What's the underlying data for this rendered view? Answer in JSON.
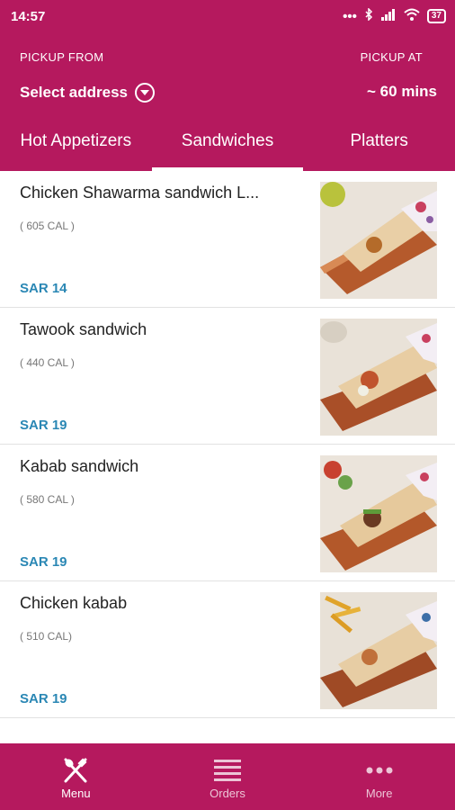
{
  "status_bar": {
    "time": "14:57",
    "battery": "37"
  },
  "header": {
    "pickup_from_label": "PICKUP FROM",
    "address": "Select address",
    "pickup_at_label": "PICKUP AT",
    "eta": "~ 60 mins"
  },
  "tabs": [
    {
      "label": "Hot Appetizers"
    },
    {
      "label": "Sandwiches"
    },
    {
      "label": "Platters"
    }
  ],
  "items": [
    {
      "name": "Chicken Shawarma sandwich L...",
      "calories": "( 605 CAL )",
      "price": "SAR 14"
    },
    {
      "name": "Tawook sandwich",
      "calories": "( 440 CAL )",
      "price": "SAR 19"
    },
    {
      "name": "Kabab sandwich",
      "calories": "( 580 CAL )",
      "price": "SAR 19"
    },
    {
      "name": "Chicken kabab",
      "calories": "( 510 CAL)",
      "price": "SAR 19"
    }
  ],
  "bottom_nav": [
    {
      "label": "Menu",
      "icon": "fork-knife-icon"
    },
    {
      "label": "Orders",
      "icon": "list-icon"
    },
    {
      "label": "More",
      "icon": "more-dots-icon"
    }
  ],
  "colors": {
    "brand": "#b5195e",
    "price": "#2a87b4"
  }
}
